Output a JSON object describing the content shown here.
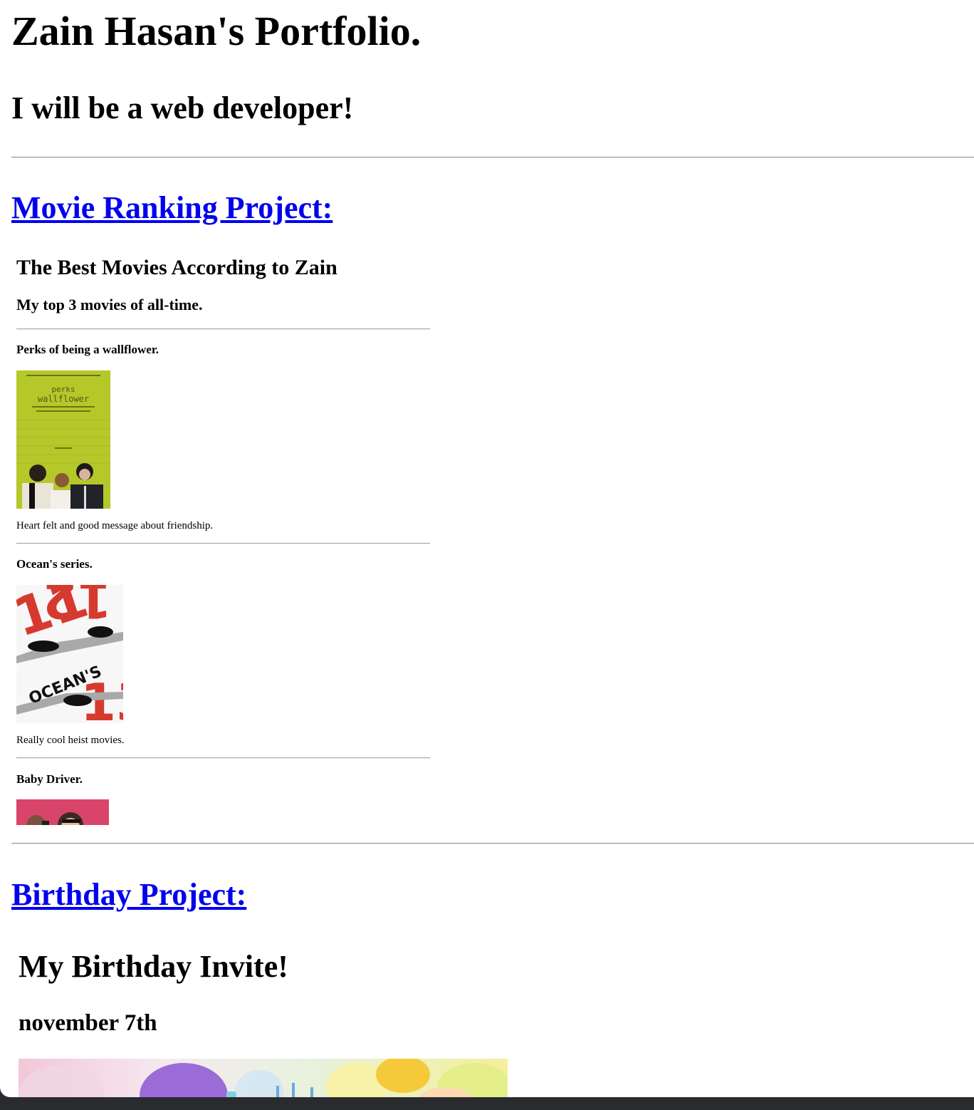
{
  "header": {
    "title": "Zain Hasan's Portfolio.",
    "subtitle": "I will be a web developer!"
  },
  "projects": [
    {
      "link": "Movie Ranking Project:",
      "embed": {
        "heading": "The Best Movies According to Zain",
        "subheading": "My top 3 movies of all-time.",
        "movies": [
          {
            "title": "Perks of being a wallflower.",
            "poster_icon": "perks-of-being-a-wallflower-poster",
            "description": "Heart felt and good message about friendship."
          },
          {
            "title": "Ocean's series.",
            "poster_icon": "oceans-trilogy-poster",
            "description": "Really cool heist movies."
          },
          {
            "title": "Baby Driver.",
            "poster_icon": "baby-driver-poster",
            "description": ""
          }
        ]
      }
    },
    {
      "link": "Birthday Project:",
      "embed": {
        "heading": "My Birthday Invite!",
        "date": "november 7th",
        "image_icon": "birthday-balloons-image"
      }
    }
  ],
  "colors": {
    "link": "#0000ee",
    "page_background": "#ffffff",
    "window_frame": "#2a2b2e",
    "perks_poster": "#b5c82a",
    "oceans_red": "#d63a2f",
    "baby_driver_pink": "#d9456a"
  }
}
